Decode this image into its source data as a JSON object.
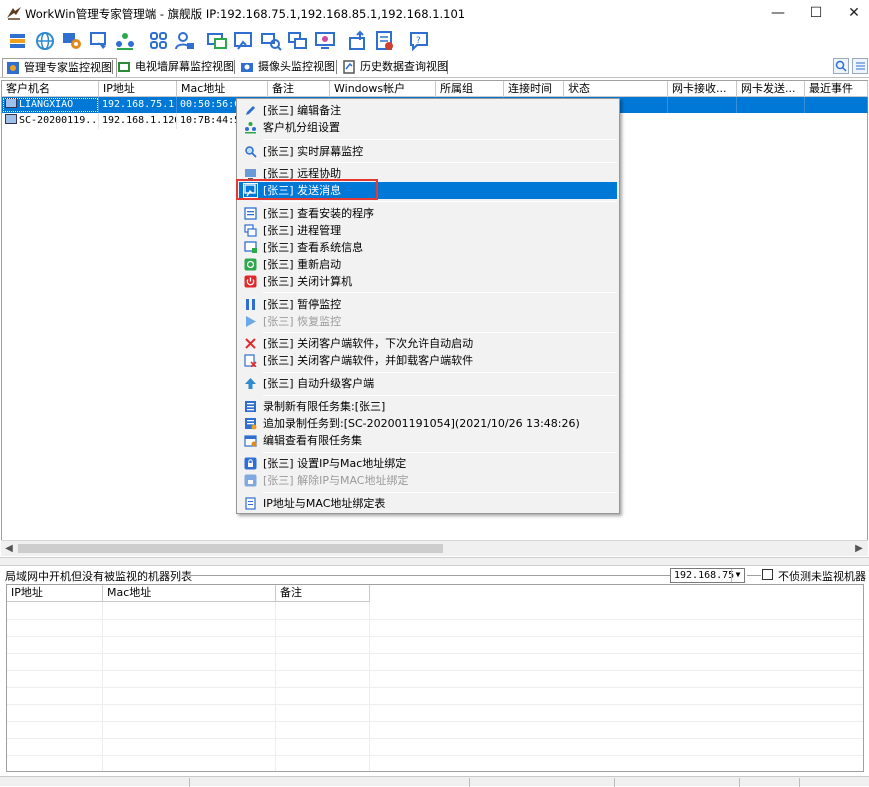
{
  "window": {
    "title": "WorkWin管理专家管理端 - 旗舰版 IP:192.168.75.1,192.168.85.1,192.168.1.101",
    "minimize_glyph": "—",
    "maximize_glyph": "☐",
    "close_glyph": "✕"
  },
  "toolbar": {
    "buttons": [
      {
        "icon": "stack-icon",
        "color": "#2f6fd0"
      },
      {
        "icon": "globe-icon",
        "color": "#2f8ad0"
      },
      {
        "icon": "users-settings-icon",
        "color": "#e08a1e"
      },
      {
        "icon": "screen-monitor-icon",
        "color": "#2f6fd0"
      },
      {
        "icon": "group-icon",
        "color": "#2aa84a"
      },
      {
        "icon": "grid-icon",
        "color": "#2f6fd0"
      },
      {
        "icon": "user-lock-icon",
        "color": "#2f6fd0"
      },
      {
        "icon": "remote-desktop-icon",
        "color": "#2f6fd0"
      },
      {
        "icon": "send-message-icon",
        "color": "#2f6fd0"
      },
      {
        "icon": "search-computer-icon",
        "color": "#2f6fd0"
      },
      {
        "icon": "window-copy-icon",
        "color": "#2f6fd0"
      },
      {
        "icon": "monitor-icon",
        "color": "#2f6fd0"
      },
      {
        "icon": "upload-icon",
        "color": "#2f6fd0"
      },
      {
        "icon": "report-icon",
        "color": "#d0402f"
      },
      {
        "icon": "chat-help-icon",
        "color": "#2f6fd0"
      }
    ]
  },
  "tabs": [
    {
      "label": "管理专家监控视图",
      "icon": "monitor-view-icon"
    },
    {
      "label": "电视墙屏幕监控视图",
      "icon": "tv-wall-icon"
    },
    {
      "label": "摄像头监控视图",
      "icon": "camera-icon"
    },
    {
      "label": "历史数据查询视图",
      "icon": "history-icon"
    }
  ],
  "grid": {
    "columns": [
      "客户机名",
      "IP地址",
      "Mac地址",
      "备注",
      "Windows帐户",
      "所属组",
      "连接时间",
      "状态",
      "网卡接收...",
      "网卡发送...",
      "最近事件"
    ],
    "rows": [
      {
        "name": "LIANGXIAO",
        "ip": "192.168.75.1",
        "mac": "00:50:56:C0",
        "selected": true
      },
      {
        "name": "SC-20200119...",
        "ip": "192.168.1.120",
        "mac": "10:7B:44:50",
        "selected": false
      }
    ]
  },
  "context_menu": {
    "items": [
      {
        "label": "[张三] 编辑备注",
        "icon": "pencil-icon"
      },
      {
        "label": "客户机分组设置",
        "icon": "group-icon"
      },
      {
        "sep": true
      },
      {
        "label": "[张三] 实时屏幕监控",
        "icon": "magnifier-icon"
      },
      {
        "sep": true
      },
      {
        "label": "[张三] 远程协助",
        "icon": "remote-assist-icon"
      },
      {
        "label": "[张三] 发送消息",
        "icon": "send-message-icon",
        "highlighted": true
      },
      {
        "sep": true
      },
      {
        "label": "[张三] 查看安装的程序",
        "icon": "programs-icon"
      },
      {
        "label": "[张三] 进程管理",
        "icon": "process-icon"
      },
      {
        "label": "[张三] 查看系统信息",
        "icon": "system-info-icon"
      },
      {
        "label": "[张三] 重新启动",
        "icon": "restart-icon"
      },
      {
        "label": "[张三] 关闭计算机",
        "icon": "power-icon"
      },
      {
        "sep": true
      },
      {
        "label": "[张三] 暂停监控",
        "icon": "pause-icon"
      },
      {
        "label": "[张三] 恢复监控",
        "icon": "play-icon",
        "disabled": true
      },
      {
        "sep": true
      },
      {
        "label": "[张三] 关闭客户端软件，下次允许自动启动",
        "icon": "close-x-icon"
      },
      {
        "label": "[张三] 关闭客户端软件，并卸载客户端软件",
        "icon": "uninstall-icon"
      },
      {
        "sep": true
      },
      {
        "label": "[张三] 自动升级客户端",
        "icon": "upgrade-icon"
      },
      {
        "sep": true
      },
      {
        "label": "录制新有限任务集:[张三]",
        "icon": "record-icon"
      },
      {
        "label": "追加录制任务到:[SC-202001191054](2021/10/26 13:48:26)",
        "icon": "append-record-icon"
      },
      {
        "label": "编辑查看有限任务集",
        "icon": "task-edit-icon"
      },
      {
        "sep": true
      },
      {
        "label": "[张三] 设置IP与Mac地址绑定",
        "icon": "lock-icon"
      },
      {
        "label": "[张三] 解除IP与MAC地址绑定",
        "icon": "unlock-icon",
        "disabled": true
      },
      {
        "sep": true
      },
      {
        "label": "IP地址与MAC地址绑定表",
        "icon": "table-icon"
      }
    ]
  },
  "lan_panel": {
    "title": "局域网中开机但没有被监视的机器列表",
    "ip_select_value": "192.168.75",
    "checkbox_label": "不侦测未监视机器",
    "checkbox_checked": false,
    "columns": [
      "IP地址",
      "Mac地址",
      "备注"
    ]
  },
  "colors": {
    "selection": "#0078d7",
    "highlight_box": "#e53935"
  }
}
